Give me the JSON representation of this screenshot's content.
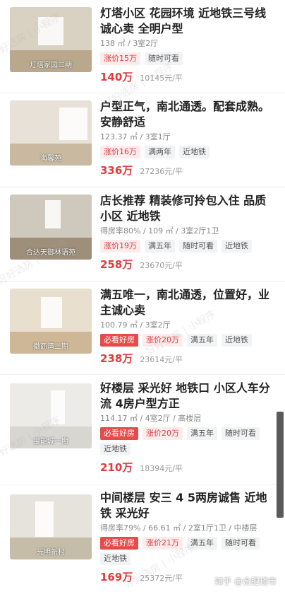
{
  "listings": [
    {
      "thumb_caption": "灯塔家园二期",
      "title": "灯塔小区 花园环境 近地铁三号线诚心卖 全明户型",
      "meta": "138 ㎡ / 3室2厅",
      "tags": [
        "涨价15万",
        "随时可看"
      ],
      "price": "140万",
      "unit_price": "10145元/平",
      "colors": {
        "bg": "#d9d2c3",
        "floor": "#b9a88c"
      }
    },
    {
      "thumb_caption": "海馨苑",
      "title": "户型正气，南北通透。配套成熟。安静舒适",
      "meta": "123.37 ㎡ / 3室1厅",
      "tags": [
        "涨价16万",
        "满两年",
        "近地铁"
      ],
      "price": "336万",
      "unit_price": "27236元/平",
      "colors": {
        "bg": "#e7e1d8",
        "floor": "#c9b9a1"
      }
    },
    {
      "thumb_caption": "合达天御林语苑",
      "title": "店长推荐 精装修可拎包入住 品质小区 近地铁",
      "meta": "得房率80% / 109 ㎡ / 3室2厅1卫",
      "tags": [
        "涨价19万",
        "满五年",
        "随时可看",
        "近地铁"
      ],
      "price": "258万",
      "unit_price": "23670元/平",
      "colors": {
        "bg": "#cfc8bd",
        "floor": "#9e8f7a"
      }
    },
    {
      "thumb_caption": "徽商湾二期",
      "title": "满五唯一，南北通透，位置好，业主诚心卖",
      "meta": "100.79 ㎡ / 3室2厅",
      "tags": [
        "必看好房",
        "涨价20万",
        "满五年",
        "近地铁"
      ],
      "price": "238万",
      "unit_price": "23614元/平",
      "colors": {
        "bg": "#e8dfcf",
        "floor": "#cdb797"
      }
    },
    {
      "thumb_caption": "宝能城一期",
      "title": "好楼层 采光好 地铁口 小区人车分流 4房户型方正",
      "meta": "114.17 ㎡ / 4室2厅 / 高楼层",
      "tags": [
        "必看好房",
        "涨价20万",
        "满五年",
        "随时可看",
        "近地铁"
      ],
      "price": "210万",
      "unit_price": "18394元/平",
      "colors": {
        "bg": "#ecebe8",
        "floor": "#d8d6d1"
      }
    },
    {
      "thumb_caption": "光明新村",
      "title": "中间楼层 安三 4 5两房诚售 近地铁 采光好",
      "meta": "得房率79% / 66.61 ㎡ / 2室1厅1卫 / 中楼层",
      "tags": [
        "必看好房",
        "涨价21万",
        "满五年",
        "随时可看",
        "近地铁"
      ],
      "price": "169万",
      "unit_price": "25372元/平",
      "colors": {
        "bg": "#e6e3dc",
        "floor": "#c6bda9"
      }
    }
  ],
  "watermark_text": "好好选房 | 小程序",
  "footer_watermark": "知乎 @合肥楼市"
}
